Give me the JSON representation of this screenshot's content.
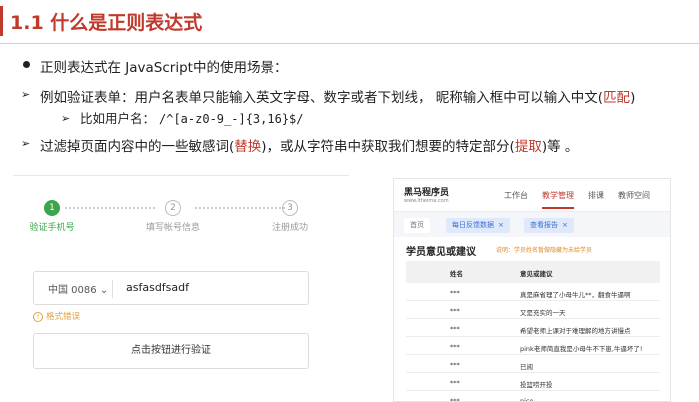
{
  "title": "1.1 什么是正则表达式",
  "bullets": {
    "b1": "正则表达式在 JavaScript中的使用场景：",
    "b2_pre": "例如验证表单：用户名表单只能输入英文字母、数字或者下划线， 昵称输入框中可以输入中文(",
    "b2_hl": "匹配",
    "b2_post": ")",
    "b3_label": "比如用户名：",
    "b3_regex": "/^[a-z0-9_-]{3,16}$/",
    "b4_pre": "过滤掉页面内容中的一些敏感词(",
    "b4_hl1": "替换",
    "b4_mid": ")，或从字符串中获取我们想要的特定部分(",
    "b4_hl2": "提取",
    "b4_post": ")等 。"
  },
  "register": {
    "steps": [
      {
        "num": "1",
        "label": "验证手机号",
        "active": true
      },
      {
        "num": "2",
        "label": "填写帐号信息",
        "active": false
      },
      {
        "num": "3",
        "label": "注册成功",
        "active": false
      }
    ],
    "country": "中国 0086",
    "country_caret": "⌄",
    "phone_value": "asfasdfsadf",
    "warn_icon": "!",
    "warning": "格式错误",
    "verify_button": "点击按钮进行验证",
    "colors": {
      "active_step": "#3aa54a"
    }
  },
  "admin": {
    "logo": "黑马程序员",
    "logo_sub": "www.itheima.com",
    "nav": [
      "工作台",
      "教学管理",
      "排课",
      "教师空间"
    ],
    "active_nav": "教学管理",
    "tabs": [
      {
        "label": "首页",
        "closable": false,
        "active": false
      },
      {
        "label": "每日反馈数据",
        "closable": true,
        "active": true
      },
      {
        "label": "查看报告",
        "closable": true,
        "active": true
      }
    ],
    "tab_close_icon": "×",
    "section_title": "学员意见或建议",
    "section_note": "说明：学员姓名暂做隐藏为未给学员",
    "columns": [
      "姓名",
      "意见或建议"
    ],
    "rows": [
      [
        "***",
        "真是麻省理了小母牛儿**，翻食牛逼啊"
      ],
      [
        "***",
        "又是充实的一天"
      ],
      [
        "***",
        "希望老师上课对于难理解的地方讲慢点"
      ],
      [
        "***",
        "pink老师简直我是小母牛不下崽,牛逼坏了!"
      ],
      [
        "***",
        "已阅"
      ],
      [
        "***",
        "投篮唠开投"
      ],
      [
        "***",
        "nice"
      ]
    ]
  }
}
